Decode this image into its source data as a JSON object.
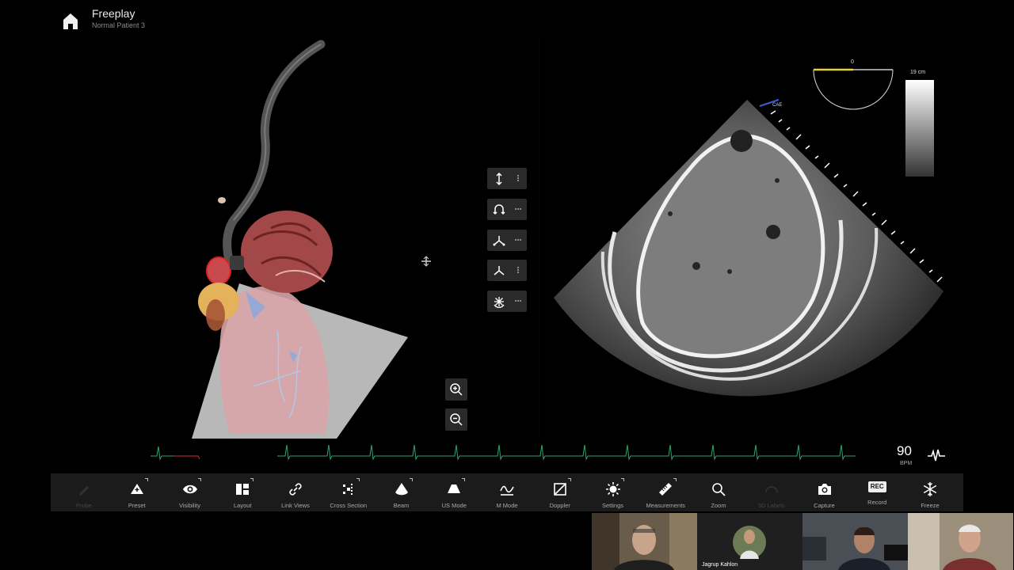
{
  "header": {
    "title": "Freeplay",
    "subtitle": "Normal Patient 3"
  },
  "probe_tools": [
    {
      "name": "depth-tool",
      "icon": "vertical-arrows-icon"
    },
    {
      "name": "rotate-tool",
      "icon": "rotate-icon"
    },
    {
      "name": "tilt-tool",
      "icon": "tilt-icon"
    },
    {
      "name": "flex-tool",
      "icon": "flex-icon"
    },
    {
      "name": "omni-tool",
      "icon": "omniplane-icon"
    }
  ],
  "scale": {
    "angle_label": "0",
    "depth_label": "19 cm"
  },
  "probe_marker": "CAE",
  "vitals": {
    "heart_rate": "90",
    "unit": "BPM"
  },
  "toolbar": {
    "items": [
      {
        "label": "Probe",
        "icon": "probe-icon",
        "disabled": true
      },
      {
        "label": "Preset",
        "icon": "preset-icon"
      },
      {
        "label": "Visibility",
        "icon": "eye-icon"
      },
      {
        "label": "Layout",
        "icon": "layout-icon"
      },
      {
        "label": "Link Views",
        "icon": "link-icon"
      },
      {
        "label": "Cross Section",
        "icon": "cross-section-icon"
      },
      {
        "label": "Beam",
        "icon": "beam-icon"
      },
      {
        "label": "US Mode",
        "icon": "us-mode-icon"
      },
      {
        "label": "M Mode",
        "icon": "m-mode-icon"
      },
      {
        "label": "Doppler",
        "icon": "doppler-icon"
      },
      {
        "label": "Settings",
        "icon": "settings-icon"
      },
      {
        "label": "Measurements",
        "icon": "ruler-icon"
      },
      {
        "label": "Zoom",
        "icon": "magnifier-icon"
      },
      {
        "label": "3D Labels",
        "icon": "labels-icon",
        "disabled": true
      },
      {
        "label": "Capture",
        "icon": "camera-icon"
      },
      {
        "label": "Record",
        "icon": "rec-icon",
        "rec_text": "REC"
      },
      {
        "label": "Freeze",
        "icon": "snowflake-icon"
      }
    ]
  },
  "participants": [
    {
      "name": ""
    },
    {
      "name": "Jagrup Kahlon"
    },
    {
      "name": ""
    },
    {
      "name": ""
    }
  ],
  "colors": {
    "accent_yellow": "#e8d12e",
    "ecg_green": "#2fa36b",
    "ecg_red": "#d03030",
    "toolbar_bg": "#1b1b1b"
  }
}
